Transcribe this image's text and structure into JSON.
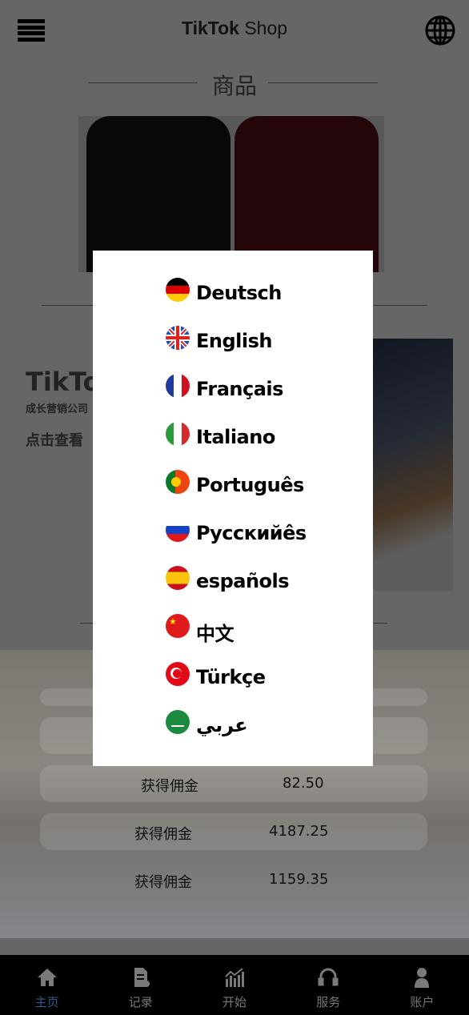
{
  "header": {
    "logo_bold": "TikTok",
    "logo_light": "Shop"
  },
  "products": {
    "title": "商品"
  },
  "promo": {
    "title": "TikTok",
    "subtitle": "成长营销公司",
    "link": "点击查看"
  },
  "commissions": [
    {
      "label": "获得佣金",
      "value": "82.50"
    },
    {
      "label": "获得佣金",
      "value": "4187.25"
    },
    {
      "label": "获得佣金",
      "value": "1159.35"
    }
  ],
  "nav": [
    {
      "label": "主页",
      "icon": "home-icon",
      "active": true
    },
    {
      "label": "记录",
      "icon": "document-icon"
    },
    {
      "label": "开始",
      "icon": "chart-icon"
    },
    {
      "label": "服务",
      "icon": "headset-icon"
    },
    {
      "label": "账户",
      "icon": "user-icon"
    }
  ],
  "languages": [
    {
      "label": "Deutsch",
      "flag": "germany-flag-icon"
    },
    {
      "label": "English",
      "flag": "uk-flag-icon"
    },
    {
      "label": "Français",
      "flag": "france-flag-icon"
    },
    {
      "label": "Italiano",
      "flag": "italy-flag-icon"
    },
    {
      "label": "Português",
      "flag": "portugal-flag-icon"
    },
    {
      "label": "Русскийês",
      "flag": "russia-flag-icon"
    },
    {
      "label": "españols",
      "flag": "spain-flag-icon"
    },
    {
      "label": "中文",
      "flag": "china-flag-icon"
    },
    {
      "label": "Türkçe",
      "flag": "turkey-flag-icon"
    },
    {
      "label": "عربي",
      "flag": "saudi-flag-icon"
    }
  ],
  "colors": {
    "overlay": "rgba(0,0,0,0.6)",
    "nav_active": "#2f5b8c",
    "nav_bg": "#000000"
  }
}
